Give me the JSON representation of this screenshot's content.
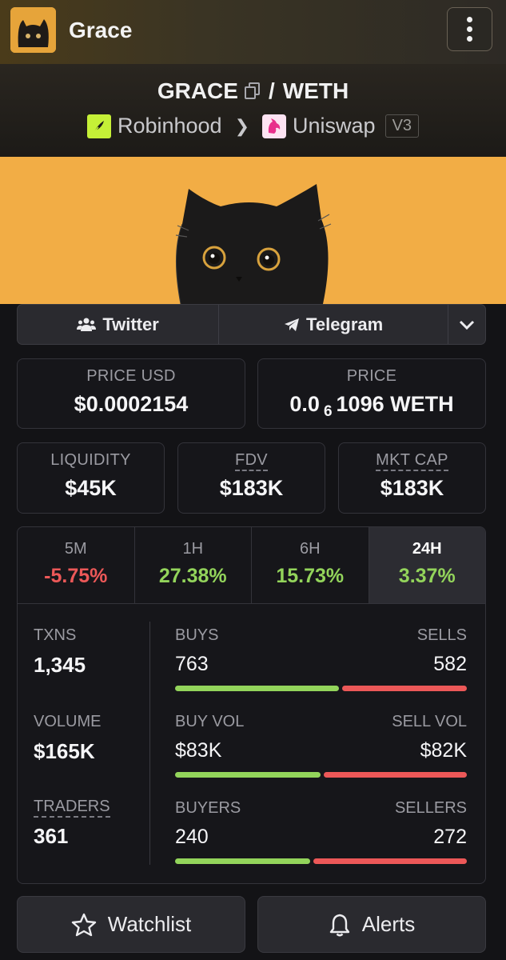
{
  "header": {
    "app_title": "Grace",
    "menu_icon": "kebab-menu-icon"
  },
  "pair": {
    "base": "GRACE",
    "separator": "/",
    "quote": "WETH",
    "chain": "Robinhood",
    "dex": "Uniswap",
    "version": "V3"
  },
  "social": {
    "twitter": "Twitter",
    "telegram": "Telegram"
  },
  "price": {
    "usd_label": "PRICE USD",
    "usd_value": "$0.0002154",
    "native_label": "PRICE",
    "native_prefix": "0.0",
    "native_subscript": "6",
    "native_rest": "1096 WETH"
  },
  "metrics": {
    "liquidity_label": "LIQUIDITY",
    "liquidity_value": "$45K",
    "fdv_label": "FDV",
    "fdv_value": "$183K",
    "mktcap_label": "MKT CAP",
    "mktcap_value": "$183K"
  },
  "periods": [
    {
      "label": "5M",
      "change": "-5.75%",
      "active": false
    },
    {
      "label": "1H",
      "change": "27.38%",
      "active": false
    },
    {
      "label": "6H",
      "change": "15.73%",
      "active": false
    },
    {
      "label": "24H",
      "change": "3.37%",
      "active": true
    }
  ],
  "stats": {
    "txns_label": "TXNS",
    "txns_value": "1,345",
    "volume_label": "VOLUME",
    "volume_value": "$165K",
    "traders_label": "TRADERS",
    "traders_value": "361",
    "buys_label": "BUYS",
    "buys_value": "763",
    "sells_label": "SELLS",
    "sells_value": "582",
    "buy_share": 0.567,
    "buyvol_label": "BUY VOL",
    "buyvol_value": "$83K",
    "sellvol_label": "SELL VOL",
    "sellvol_value": "$82K",
    "buyvol_share": 0.503,
    "buyers_label": "BUYERS",
    "buyers_value": "240",
    "sellers_label": "SELLERS",
    "sellers_value": "272",
    "buyers_share": 0.469
  },
  "actions": {
    "watchlist": "Watchlist",
    "alerts": "Alerts"
  },
  "colors": {
    "positive": "#93d45b",
    "negative": "#ec5858",
    "banner": "#f2ad45",
    "chain_badge": "#c5f037"
  }
}
